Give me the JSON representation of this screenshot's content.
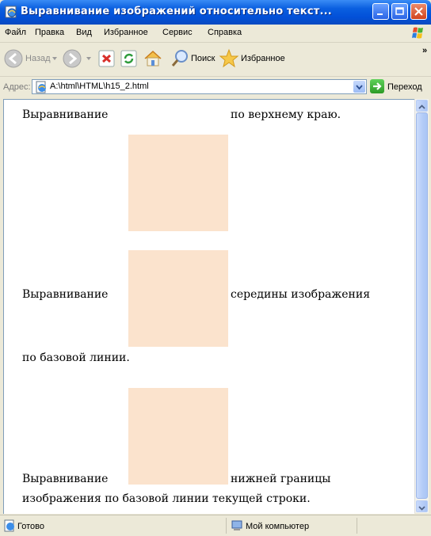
{
  "window": {
    "title": "Выравнивание изображений относительно текст..."
  },
  "menu": {
    "items": [
      "Файл",
      "Правка",
      "Вид",
      "Избранное",
      "Сервис",
      "Справка"
    ]
  },
  "toolbar": {
    "back_label": "Назад",
    "search_label": "Поиск",
    "favorites_label": "Избранное",
    "more": "»"
  },
  "address": {
    "label": "Адрес:",
    "value": "A:\\html\\HTML\\h15_2.html",
    "go_label": "Переход"
  },
  "page": {
    "p1_before": "Выравнивание",
    "p1_after": "по верхнему краю.",
    "p2_before": "Выравнивание",
    "p2_after": "середины изображения",
    "p2_line2": "по базовой линии.",
    "p3_before": "Выравнивание",
    "p3_after": "нижней границы",
    "p3_line2": "изображения по базовой линии текущей строки."
  },
  "status": {
    "left": "Готово",
    "zone": "Мой компьютер"
  },
  "colors": {
    "image_fill": "#fbe3cd",
    "titlebar": "#0a5fe0"
  }
}
